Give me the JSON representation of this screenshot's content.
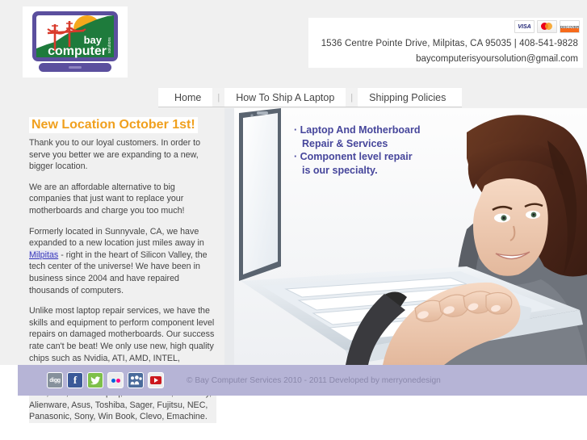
{
  "header": {
    "logo": {
      "name": "bay-computer-solutions-logo",
      "brand_line1": "bay",
      "brand_line2": "computer",
      "brand_sub": "solutions"
    },
    "cards": [
      {
        "name": "visa-card-icon",
        "label": "VISA"
      },
      {
        "name": "mastercard-card-icon",
        "label": "MasterCard"
      },
      {
        "name": "discover-card-icon",
        "label": "DISCOVER"
      }
    ],
    "address": "1536 Centre Pointe Drive, Milpitas, CA 95035   |   408-541-9828",
    "email": "baycomputerisyoursolution@gmail.com"
  },
  "nav": {
    "items": [
      {
        "label": "Home"
      },
      {
        "label": "How To Ship A Laptop"
      },
      {
        "label": "Shipping Policies"
      }
    ],
    "separator": "|"
  },
  "main": {
    "headline": "New  Location October 1st!",
    "paragraphs": [
      "Thank you to our loyal customers. In order to serve you better we are expanding to a new, bigger location.",
      "We are an affordable alternative to big companies that just want to replace your motherboards and charge you too much!",
      "Unlike most laptop repair services, we have the skills and equipment to perform component level repairs on damaged motherboards. Our success rate can't be beat! We only use new, high quality chips such as Nvidia, ATI, AMD, INTEL, BROADCOM, and Maxim. We specialize in repairing the following brands of laptops: Apple, Acer, Dell, HP/ Compaq, IBM/Lenovo, Gateway, Alienware, Asus, Toshiba, Sager, Fujitsu, NEC, Panasonic, Sony, Win Book, Clevo, Emachine."
    ],
    "paragraph_with_link": {
      "before": "Formerly located in Sunnyvale, CA, we have expanded to a new location just miles away in ",
      "link_text": "Milpitas",
      "after": " - right in the heart of Silicon Valley, the tech center of the universe! We have been in business since 2004 and have repaired thousands of computers."
    }
  },
  "hero": {
    "bullets": [
      {
        "line1": "· Laptop And Motherboard",
        "line2": "Repair & Services"
      },
      {
        "line1": "· Component level repair",
        "line2": "is our specialty."
      }
    ],
    "alt": "woman typing on a white laptop"
  },
  "footer": {
    "social": [
      {
        "name": "digg-icon",
        "label": "digg"
      },
      {
        "name": "facebook-icon",
        "label": "f"
      },
      {
        "name": "twitter-icon",
        "label": "t"
      },
      {
        "name": "flickr-icon",
        "label": "flickr"
      },
      {
        "name": "myspace-icon",
        "label": "myspace"
      },
      {
        "name": "youtube-icon",
        "label": "YouTube"
      }
    ],
    "copyright": "© Bay Computer Services 2010 - 2011 Developed by merryonedesign"
  },
  "colors": {
    "accent_orange": "#f0a01e",
    "brand_purple": "#5b4f9e",
    "hero_text": "#46469b",
    "footer_bg": "#b6b4d6",
    "link_blue": "#3b3bbb"
  }
}
